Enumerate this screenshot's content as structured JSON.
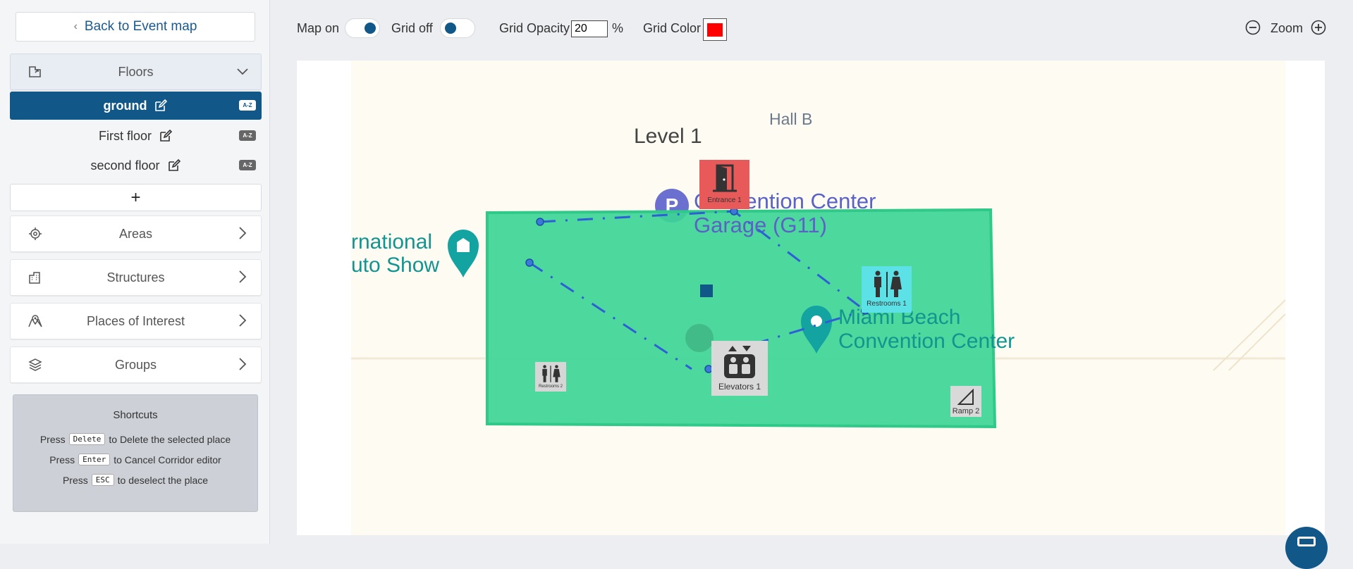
{
  "sidebar": {
    "back_label": "Back to Event map",
    "floors_label": "Floors",
    "floors": [
      {
        "name": "ground",
        "badge": "A-Z",
        "active": true
      },
      {
        "name": "First floor",
        "badge": "A-Z",
        "active": false
      },
      {
        "name": "second floor",
        "badge": "A-Z",
        "active": false
      }
    ],
    "add_label": "+",
    "sections": [
      {
        "label": "Areas",
        "icon": "target-icon"
      },
      {
        "label": "Structures",
        "icon": "building-icon"
      },
      {
        "label": "Places of Interest",
        "icon": "map-pin-icon"
      },
      {
        "label": "Groups",
        "icon": "layers-icon"
      }
    ],
    "shortcuts": {
      "title": "Shortcuts",
      "lines": [
        {
          "pre": "Press",
          "key": "Delete",
          "post": "to Delete the selected place"
        },
        {
          "pre": "Press",
          "key": "Enter",
          "post": "to Cancel Corridor editor"
        },
        {
          "pre": "Press",
          "key": "ESC",
          "post": "to deselect the place"
        }
      ]
    }
  },
  "toolbar": {
    "map_label": "Map on",
    "map_on": true,
    "grid_label": "Grid off",
    "grid_on": false,
    "opacity_label": "Grid Opacity",
    "opacity_value": "20",
    "opacity_unit": "%",
    "color_label": "Grid Color",
    "grid_color": "#ff0000",
    "zoom_label": "Zoom"
  },
  "map": {
    "basemap_labels": {
      "level": "Level 1",
      "hall": "Hall B",
      "garage_line1": "Convention Center",
      "garage_line2": "Garage (G11)",
      "auto_line1": "rnational",
      "auto_line2": "uto Show",
      "mbcc_line1": "Miami Beach",
      "mbcc_line2": "Convention Center"
    },
    "area_color": "#3ed597",
    "places": {
      "entrance": "Entrance 1",
      "restrooms1": "Restrooms 1",
      "restrooms2": "Restrooms 2",
      "elevators": "Elevators 1",
      "ramp": "Ramp 2"
    }
  },
  "colors": {
    "primary": "#115889",
    "link": "#1a5a92",
    "entrance_bg": "#e85a5a",
    "restroom_bg": "#5ce1e6",
    "corridor": "#2d5fd6"
  }
}
